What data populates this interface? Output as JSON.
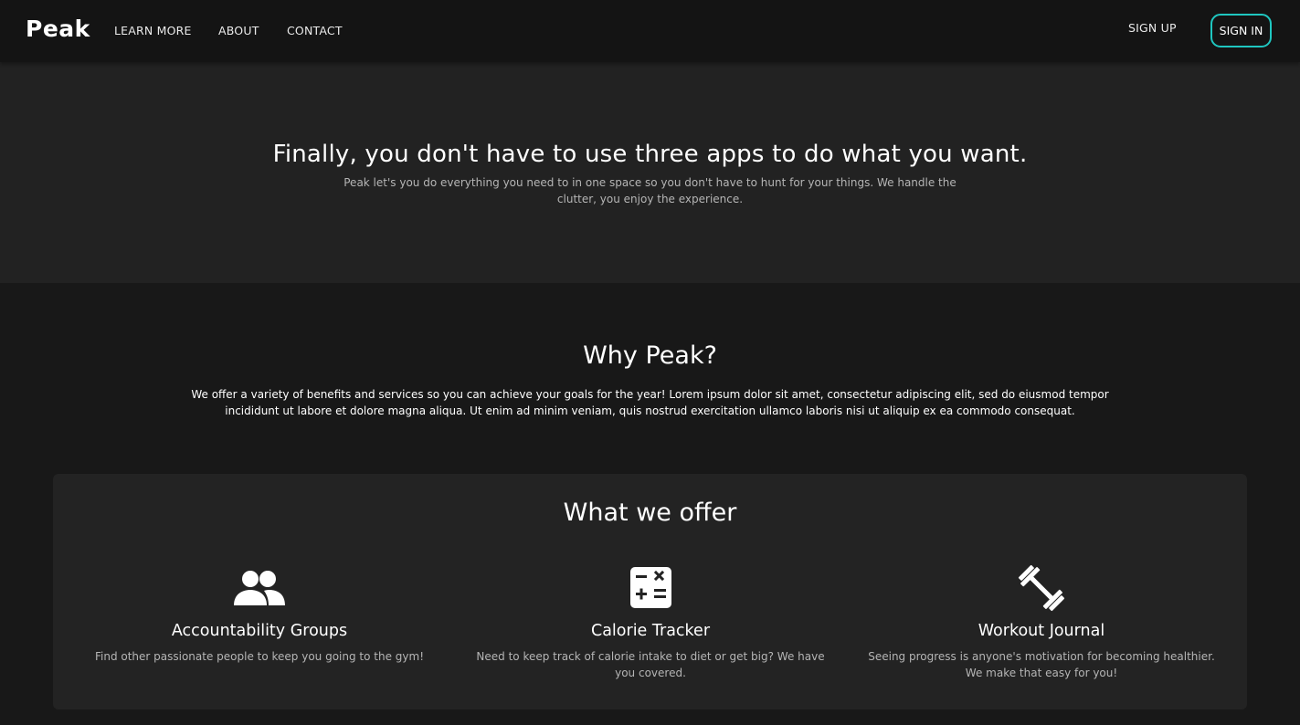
{
  "nav": {
    "brand": "Peak",
    "links": [
      "LEARN MORE",
      "ABOUT",
      "CONTACT"
    ],
    "signup": "SIGN UP",
    "signin": "SIGN IN",
    "accent_color": "#1fc6c0"
  },
  "hero": {
    "title": "Finally, you don't have to use three apps to do what you want.",
    "subtitle": "Peak let's you do everything you need to in one space so you don't have to hunt for your things. We handle the clutter, you enjoy the experience."
  },
  "why": {
    "title": "Why Peak?",
    "text": "We offer a variety of benefits and services so you can achieve your goals for the year! Lorem ipsum dolor sit amet, consectetur adipiscing elit, sed do eiusmod tempor incididunt ut labore et dolore magna aliqua. Ut enim ad minim veniam, quis nostrud exercitation ullamco laboris nisi ut aliquip ex ea commodo consequat."
  },
  "offer": {
    "title": "What we offer",
    "features": [
      {
        "icon": "group-icon",
        "name": "Accountability Groups",
        "desc": "Find other passionate people to keep you going to the gym!"
      },
      {
        "icon": "calculator-icon",
        "name": "Calorie Tracker",
        "desc": "Need to keep track of calorie intake to diet or get big? We have you covered."
      },
      {
        "icon": "dumbbell-icon",
        "name": "Workout Journal",
        "desc": "Seeing progress is anyone's motivation for becoming healthier. We make that easy for you!"
      }
    ]
  }
}
